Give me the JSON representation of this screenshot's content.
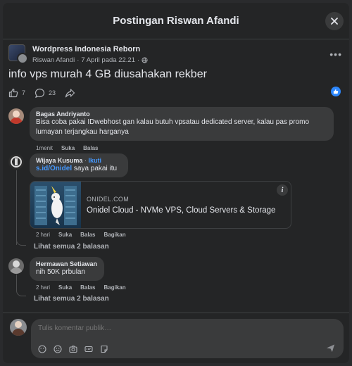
{
  "modal": {
    "title": "Postingan Riswan Afandi"
  },
  "post": {
    "group_name": "Wordpress Indonesia Reborn",
    "author": "Riswan Afandi",
    "date": "7 April pada 22.21",
    "separator": "·",
    "text": "info vps murah 4 GB diusahakan rekber",
    "like_count": "7",
    "comment_count": "23"
  },
  "comments": [
    {
      "name": "Bagas Andriyanto",
      "text": "Bisa coba pakai IDwebhost gan kalau butuh vpsatau dedicated server, kalau pas promo lumayan terjangkau harganya",
      "time": "1menit",
      "like": "Suka",
      "reply": "Balas"
    },
    {
      "name": "Wijaya Kusuma",
      "follow_sep": "·",
      "follow": "Ikuti",
      "link_text": "s.id/Onidel",
      "text": " saya pakai itu",
      "card_domain": "ONIDEL.COM",
      "card_title": "Onidel Cloud - NVMe VPS, Cloud Servers & Storage",
      "time": "2 hari",
      "like": "Suka",
      "reply": "Balas",
      "share": "Bagikan",
      "view_replies": "Lihat semua 2 balasan"
    },
    {
      "name": "Hermawan Setiawan",
      "text": "nih 50K prbulan",
      "time": "2 hari",
      "like": "Suka",
      "reply": "Balas",
      "share": "Bagikan",
      "view_replies": "Lihat semua 2 balasan"
    }
  ],
  "composer": {
    "placeholder": "Tulis komentar publik…"
  },
  "icons": [
    "close-icon",
    "globe-icon",
    "more-icon",
    "like-icon",
    "comment-icon",
    "share-icon",
    "info-icon",
    "gif-icon",
    "emoji-icon",
    "camera-icon",
    "sticker-icon",
    "send-icon"
  ],
  "colors": {
    "accent": "#2d88ff",
    "link": "#4599ff",
    "bubble": "#3a3b3c",
    "surface": "#242526"
  }
}
